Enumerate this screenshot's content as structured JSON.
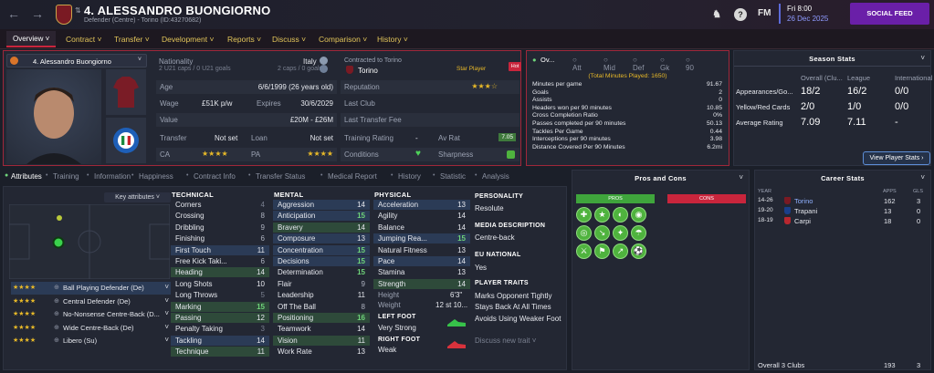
{
  "header": {
    "player_title": "4. ALESSANDRO BUONGIORNO",
    "player_sub": "Defender (Centre) - Torino (ID:43270682)",
    "fm_label": "FM",
    "date_day": "Fri 8:00",
    "date_full": "26 Dec 2025",
    "social_feed": "SOCIAL FEED",
    "help_glyph": "?"
  },
  "nav": {
    "tabs": [
      "Overview",
      "Contract",
      "Transfer",
      "Development",
      "Reports",
      "Discuss",
      "Comparison",
      "History"
    ]
  },
  "profile": {
    "selector": "4. Alessandro Buongiorno",
    "nationality_label": "Nationality",
    "nationality": "Italy",
    "u21": "2 U21 caps / 0 U21 goals",
    "caps": "2 caps / 0 goals",
    "contracted_label": "Contracted to Torino",
    "club": "Torino",
    "star_player": "Star Player",
    "hot": "Hot",
    "age_label": "Age",
    "age": "6/6/1999 (26 years old)",
    "reputation_label": "Reputation",
    "reputation_stars": "★★★☆",
    "wage_label": "Wage",
    "wage": "£51K p/w",
    "expires_label": "Expires",
    "expires": "30/6/2029",
    "last_club_label": "Last Club",
    "value_label": "Value",
    "value": "£20M - £26M",
    "last_fee_label": "Last Transfer Fee",
    "transfer_label": "Transfer",
    "transfer": "Not set",
    "loan_label": "Loan",
    "loan": "Not set",
    "training_label": "Training Rating",
    "training_val": "-",
    "avrat_label": "Av Rat",
    "avrat": "7.05",
    "ca_label": "CA",
    "ca_stars": "★★★★",
    "pa_label": "PA",
    "pa_stars": "★★★★",
    "conditions_label": "Conditions",
    "sharpness_label": "Sharpness"
  },
  "overview_stats": {
    "tabs": [
      "Ov...",
      "Att",
      "Mid",
      "Def",
      "Gk",
      "90"
    ],
    "total": "(Total Minutes Played: 1650)",
    "lines": [
      [
        "Minutes per game",
        "91.67"
      ],
      [
        "Goals",
        "2"
      ],
      [
        "Assists",
        "0"
      ],
      [
        "Headers won per 90 minutes",
        "10.85"
      ],
      [
        "Cross Completion Ratio",
        "0%"
      ],
      [
        "Passes completed per 90 minutes",
        "50.13"
      ],
      [
        "Tackles Per Game",
        "0.44"
      ],
      [
        "Interceptions per 90 minutes",
        "3.98"
      ],
      [
        "Distance Covered Per 90 Minutes",
        "6.2mi"
      ]
    ]
  },
  "season": {
    "title": "Season Stats",
    "cols": [
      "Overall (Clu...",
      "League",
      "International"
    ],
    "rows": [
      [
        "Appearances/Go...",
        "18/2",
        "16/2",
        "0/0"
      ],
      [
        "Yellow/Red Cards",
        "2/0",
        "1/0",
        "0/0"
      ],
      [
        "Average Rating",
        "7.09",
        "7.11",
        "-"
      ]
    ],
    "button": "View Player Stats"
  },
  "subtabs": [
    "Attributes",
    "Training",
    "Information",
    "Happiness",
    "Contract Info",
    "Transfer Status",
    "Medical Report",
    "History",
    "Statistic",
    "Analysis"
  ],
  "key_attributes": "Key attributes",
  "roles": [
    [
      "★★★★",
      "Ball Playing Defender (De)"
    ],
    [
      "★★★★",
      "Central Defender (De)"
    ],
    [
      "★★★★",
      "No-Nonsense Centre-Back (D..."
    ],
    [
      "★★★★",
      "Wide Centre-Back (De)"
    ],
    [
      "★★★★",
      "Libero (Su)"
    ]
  ],
  "technical": {
    "title": "TECHNICAL",
    "items": [
      [
        "Corners",
        "4"
      ],
      [
        "Crossing",
        "8"
      ],
      [
        "Dribbling",
        "9"
      ],
      [
        "Finishing",
        "6"
      ],
      [
        "First Touch",
        "11"
      ],
      [
        "Free Kick Taki...",
        "6"
      ],
      [
        "Heading",
        "14"
      ],
      [
        "Long Shots",
        "10"
      ],
      [
        "Long Throws",
        "5"
      ],
      [
        "Marking",
        "15"
      ],
      [
        "Passing",
        "12"
      ],
      [
        "Penalty Taking",
        "3"
      ],
      [
        "Tackling",
        "14"
      ],
      [
        "Technique",
        "11"
      ]
    ]
  },
  "mental": {
    "title": "MENTAL",
    "items": [
      [
        "Aggression",
        "14"
      ],
      [
        "Anticipation",
        "15"
      ],
      [
        "Bravery",
        "14"
      ],
      [
        "Composure",
        "13"
      ],
      [
        "Concentration",
        "15"
      ],
      [
        "Decisions",
        "15"
      ],
      [
        "Determination",
        "15"
      ],
      [
        "Flair",
        "9"
      ],
      [
        "Leadership",
        "11"
      ],
      [
        "Off The Ball",
        "8"
      ],
      [
        "Positioning",
        "16"
      ],
      [
        "Teamwork",
        "14"
      ],
      [
        "Vision",
        "11"
      ],
      [
        "Work Rate",
        "13"
      ]
    ]
  },
  "physical": {
    "title": "PHYSICAL",
    "items": [
      [
        "Acceleration",
        "13"
      ],
      [
        "Agility",
        "14"
      ],
      [
        "Balance",
        "14"
      ],
      [
        "Jumping Rea...",
        "15"
      ],
      [
        "Natural Fitness",
        "13"
      ],
      [
        "Pace",
        "14"
      ],
      [
        "Stamina",
        "13"
      ],
      [
        "Strength",
        "14"
      ]
    ],
    "height_label": "Height",
    "height": "6'3\"",
    "weight_label": "Weight",
    "weight": "12 st 10...",
    "left_foot_label": "LEFT FOOT",
    "left_foot": "Very Strong",
    "right_foot_label": "RIGHT FOOT",
    "right_foot": "Weak"
  },
  "personality": {
    "title": "PERSONALITY",
    "value": "Resolute",
    "media_title": "MEDIA DESCRIPTION",
    "media": "Centre-back",
    "eu_title": "EU NATIONAL",
    "eu": "Yes",
    "traits_title": "PLAYER TRAITS",
    "traits": [
      "Marks Opponent Tightly",
      "Stays Back At All Times",
      "Avoids Using Weaker Foot"
    ],
    "discuss": "Discuss new trait"
  },
  "pros_cons": {
    "title": "Pros and Cons",
    "pros": "PROS",
    "cons": "CONS"
  },
  "career": {
    "title": "Career Stats",
    "cols": [
      "YEAR",
      "APPS",
      "GLS"
    ],
    "rows": [
      [
        "14-26",
        "Torino",
        "162",
        "3"
      ],
      [
        "19-20",
        "Trapani",
        "13",
        "0"
      ],
      [
        "18-19",
        "Carpi",
        "18",
        "0"
      ]
    ],
    "overall_label": "Overall 3 Clubs",
    "overall_apps": "193",
    "overall_gls": "3"
  },
  "colors": {
    "accent": "#c9253c",
    "purple": "#6a1fa8",
    "gold": "#e8b928",
    "green": "#4fb33e"
  }
}
